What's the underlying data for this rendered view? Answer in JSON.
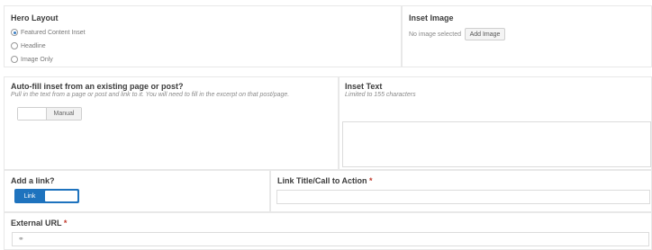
{
  "hero_layout": {
    "title": "Hero Layout",
    "options": [
      {
        "label": "Featured Content Inset",
        "checked": true
      },
      {
        "label": "Headline",
        "checked": false
      },
      {
        "label": "Image Only",
        "checked": false
      }
    ]
  },
  "inset_image": {
    "title": "Inset Image",
    "status": "No image selected",
    "add_label": "Add Image"
  },
  "autofill": {
    "title": "Auto-fill inset from an existing page or post?",
    "description": "Pull in the text from a page or post and link to it. You will need to fill in the excerpt on that post/page.",
    "toggle_off_label": "Manual"
  },
  "inset_text": {
    "title": "Inset Text",
    "description": "Limited to 155 characters"
  },
  "add_link": {
    "title": "Add a link?",
    "toggle_on_label": "Link",
    "accent": "#1e73be"
  },
  "link_title": {
    "title": "Link Title/Call to Action",
    "required": "*"
  },
  "external_url": {
    "title": "External URL",
    "required": "*",
    "icon": "link-icon"
  }
}
